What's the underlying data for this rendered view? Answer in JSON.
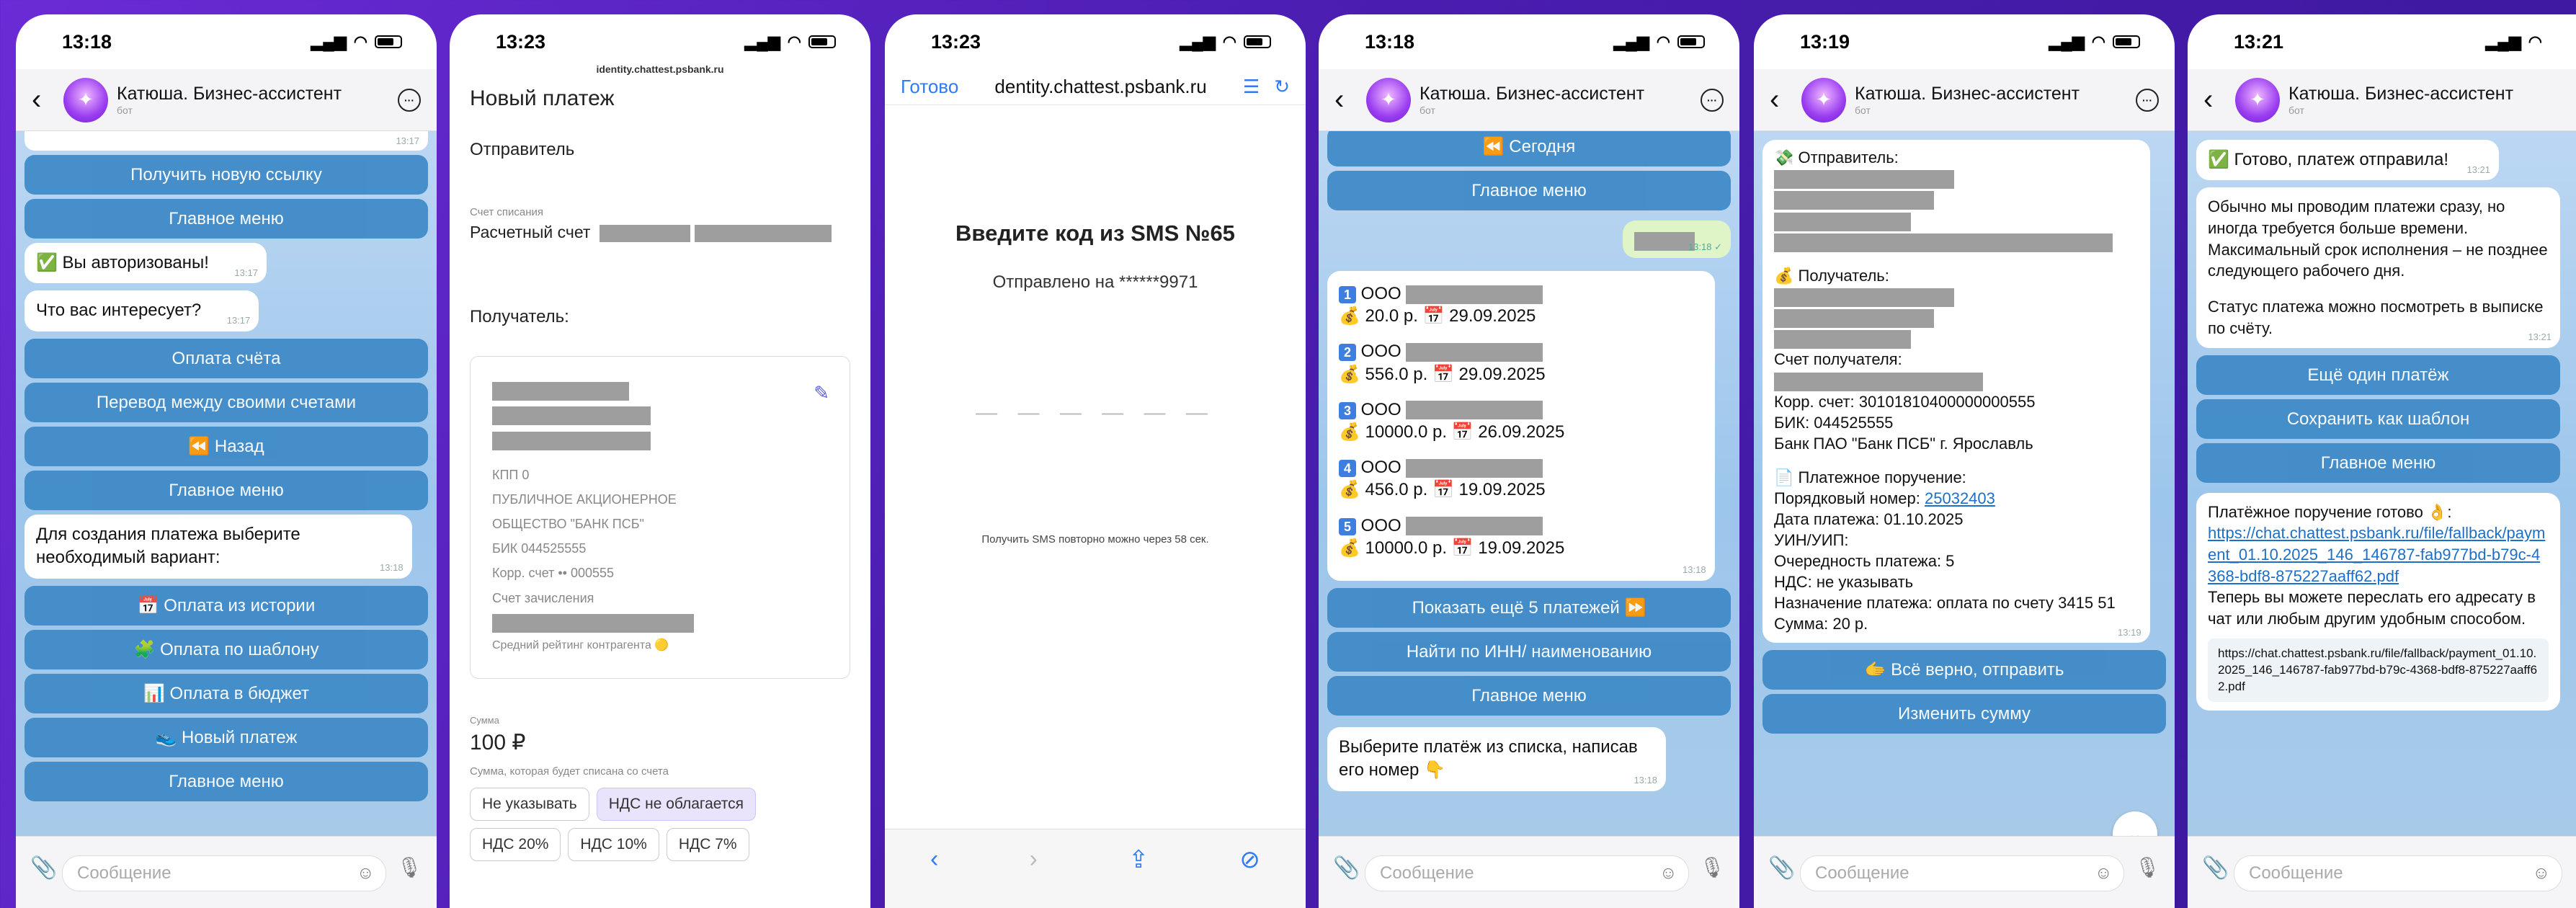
{
  "bot": {
    "name": "Катюша. Бизнес-ассистент",
    "sub": "бот",
    "input_placeholder": "Сообщение"
  },
  "screens": [
    {
      "time": "13:18",
      "items": [
        {
          "kind": "time",
          "text": "13:17"
        },
        {
          "kind": "btn",
          "text": "Получить новую ссылку"
        },
        {
          "kind": "btn",
          "text": "Главное меню"
        },
        {
          "kind": "bubble",
          "text": "✅ Вы авторизованы!",
          "time": "13:17"
        },
        {
          "kind": "bubble",
          "text": "Что вас интересует?",
          "time": "13:17"
        },
        {
          "kind": "btn",
          "text": "Оплата счёта"
        },
        {
          "kind": "btn",
          "text": "Перевод между своими счетами"
        },
        {
          "kind": "btn",
          "text": "⏪ Назад"
        },
        {
          "kind": "btn",
          "text": "Главное меню"
        },
        {
          "kind": "bubble",
          "text": "Для создания платежа выберите необходимый вариант:",
          "time": "13:18"
        },
        {
          "kind": "btn",
          "text": "📅 Оплата из истории"
        },
        {
          "kind": "btn",
          "text": "🧩 Оплата по шаблону"
        },
        {
          "kind": "btn",
          "text": "📊 Оплата в бюджет"
        },
        {
          "kind": "btn",
          "text": "👟 Новый платеж"
        },
        {
          "kind": "btn",
          "text": "Главное меню"
        }
      ]
    },
    {
      "time": "13:23",
      "url": "identity.chattest.psbank.ru",
      "title": "Новый платеж",
      "sender_label": "Отправитель",
      "account_label": "Счет списания",
      "account_value": "Расчетный счет",
      "recipient_label": "Получатель:",
      "card_lines": [
        "КПП 0",
        "ПУБЛИЧНОЕ АКЦИОНЕРНОЕ",
        "ОБЩЕСТВО \"БАНК ПСБ\"",
        "БИК 044525555",
        "Корр. счет •• 000555",
        "Счет зачисления"
      ],
      "rating": "Средний рейтинг контрагента 🟡",
      "sum_label": "Сумма",
      "sum_value": "100 ₽",
      "sum_hint": "Сумма, которая будет списана со счета",
      "vat": [
        "Не указывать",
        "НДС не облагается",
        "НДС 20%",
        "НДС 10%",
        "НДС 7%"
      ]
    },
    {
      "time": "13:23",
      "done": "Готово",
      "url": "dentity.chattest.psbank.ru",
      "heading": "Введите код из SMS №65",
      "sent_to": "Отправлено на ******9971",
      "resend": "Получить SMS повторно можно через 58 сек."
    },
    {
      "time": "13:18",
      "top_btns": [
        "⏪ Сегодня",
        "Главное меню"
      ],
      "out_time": "13:18 ✓",
      "payments": [
        {
          "n": "1",
          "org": "ООО",
          "sum": "💰 20.0 р.",
          "date": "📅 29.09.2025"
        },
        {
          "n": "2",
          "org": "ООО",
          "sum": "💰 556.0 р.",
          "date": "📅 29.09.2025"
        },
        {
          "n": "3",
          "org": "ООО",
          "sum": "💰 10000.0 р.",
          "date": "📅 26.09.2025"
        },
        {
          "n": "4",
          "org": "ООО",
          "sum": "💰 456.0 р.",
          "date": "📅 19.09.2025"
        },
        {
          "n": "5",
          "org": "ООО",
          "sum": "💰 10000.0 р.",
          "date": "📅 19.09.2025"
        }
      ],
      "list_time": "13:18",
      "btns": [
        "Показать ещё 5 платежей ⏩",
        "Найти по ИНН/ наименованию",
        "Главное меню"
      ],
      "prompt": "Выберите платёж из списка, написав его номер 👇",
      "prompt_time": "13:18"
    },
    {
      "time": "13:19",
      "sender": "💸 Отправитель:",
      "recipient": "💰 Получатель:",
      "recipient_acc": "Счет получателя:",
      "corr": "Корр. счет: 30101810400000000555",
      "bik": "БИК: 044525555",
      "bank": "Банк ПАО \"Банк ПСБ\" г. Ярославль",
      "order": "📄 Платежное поручение:",
      "order_no_label": "Порядковый номер: ",
      "order_no": "25032403",
      "order_date": "Дата платежа: 01.10.2025",
      "uin": "УИН/УИП:",
      "queue": "Очередность платежа: 5",
      "vat": "НДС: не указывать",
      "purpose": "Назначение платежа: оплата по счету 3415 51",
      "sum": "Сумма: 20 р.",
      "msg_time": "13:19",
      "btns": [
        "🫱 Всё верно, отправить",
        "Изменить сумму"
      ]
    },
    {
      "time": "13:21",
      "done": "✅ Готово, платеж отправила!",
      "done_time": "13:21",
      "info": "Обычно мы проводим платежи сразу, но иногда требуется больше времени. Максимальный срок исполнения – не позднее следующего рабочего дня.",
      "info2": "Статус платежа можно посмотреть в выписке по счёту.",
      "info_time": "13:21",
      "btns": [
        "Ещё один платёж",
        "Сохранить как шаблон",
        "Главное меню"
      ],
      "ready": "Платёжное поручение готово 👌:",
      "link": "https://chat.chattest.psbank.ru/file/fallback/payment_01.10.2025_146_146787-fab977bd-b79c-4368-bdf8-875227aaff62.pdf",
      "after": "Теперь вы можете переслать его адресату в чат или любым другим удобным способом.",
      "preview": "https://chat.chattest.psbank.ru/file/fallback/payment_01.10.2025_146_146787-fab977bd-b79c-4368-bdf8-875227aaff62.pdf"
    }
  ]
}
